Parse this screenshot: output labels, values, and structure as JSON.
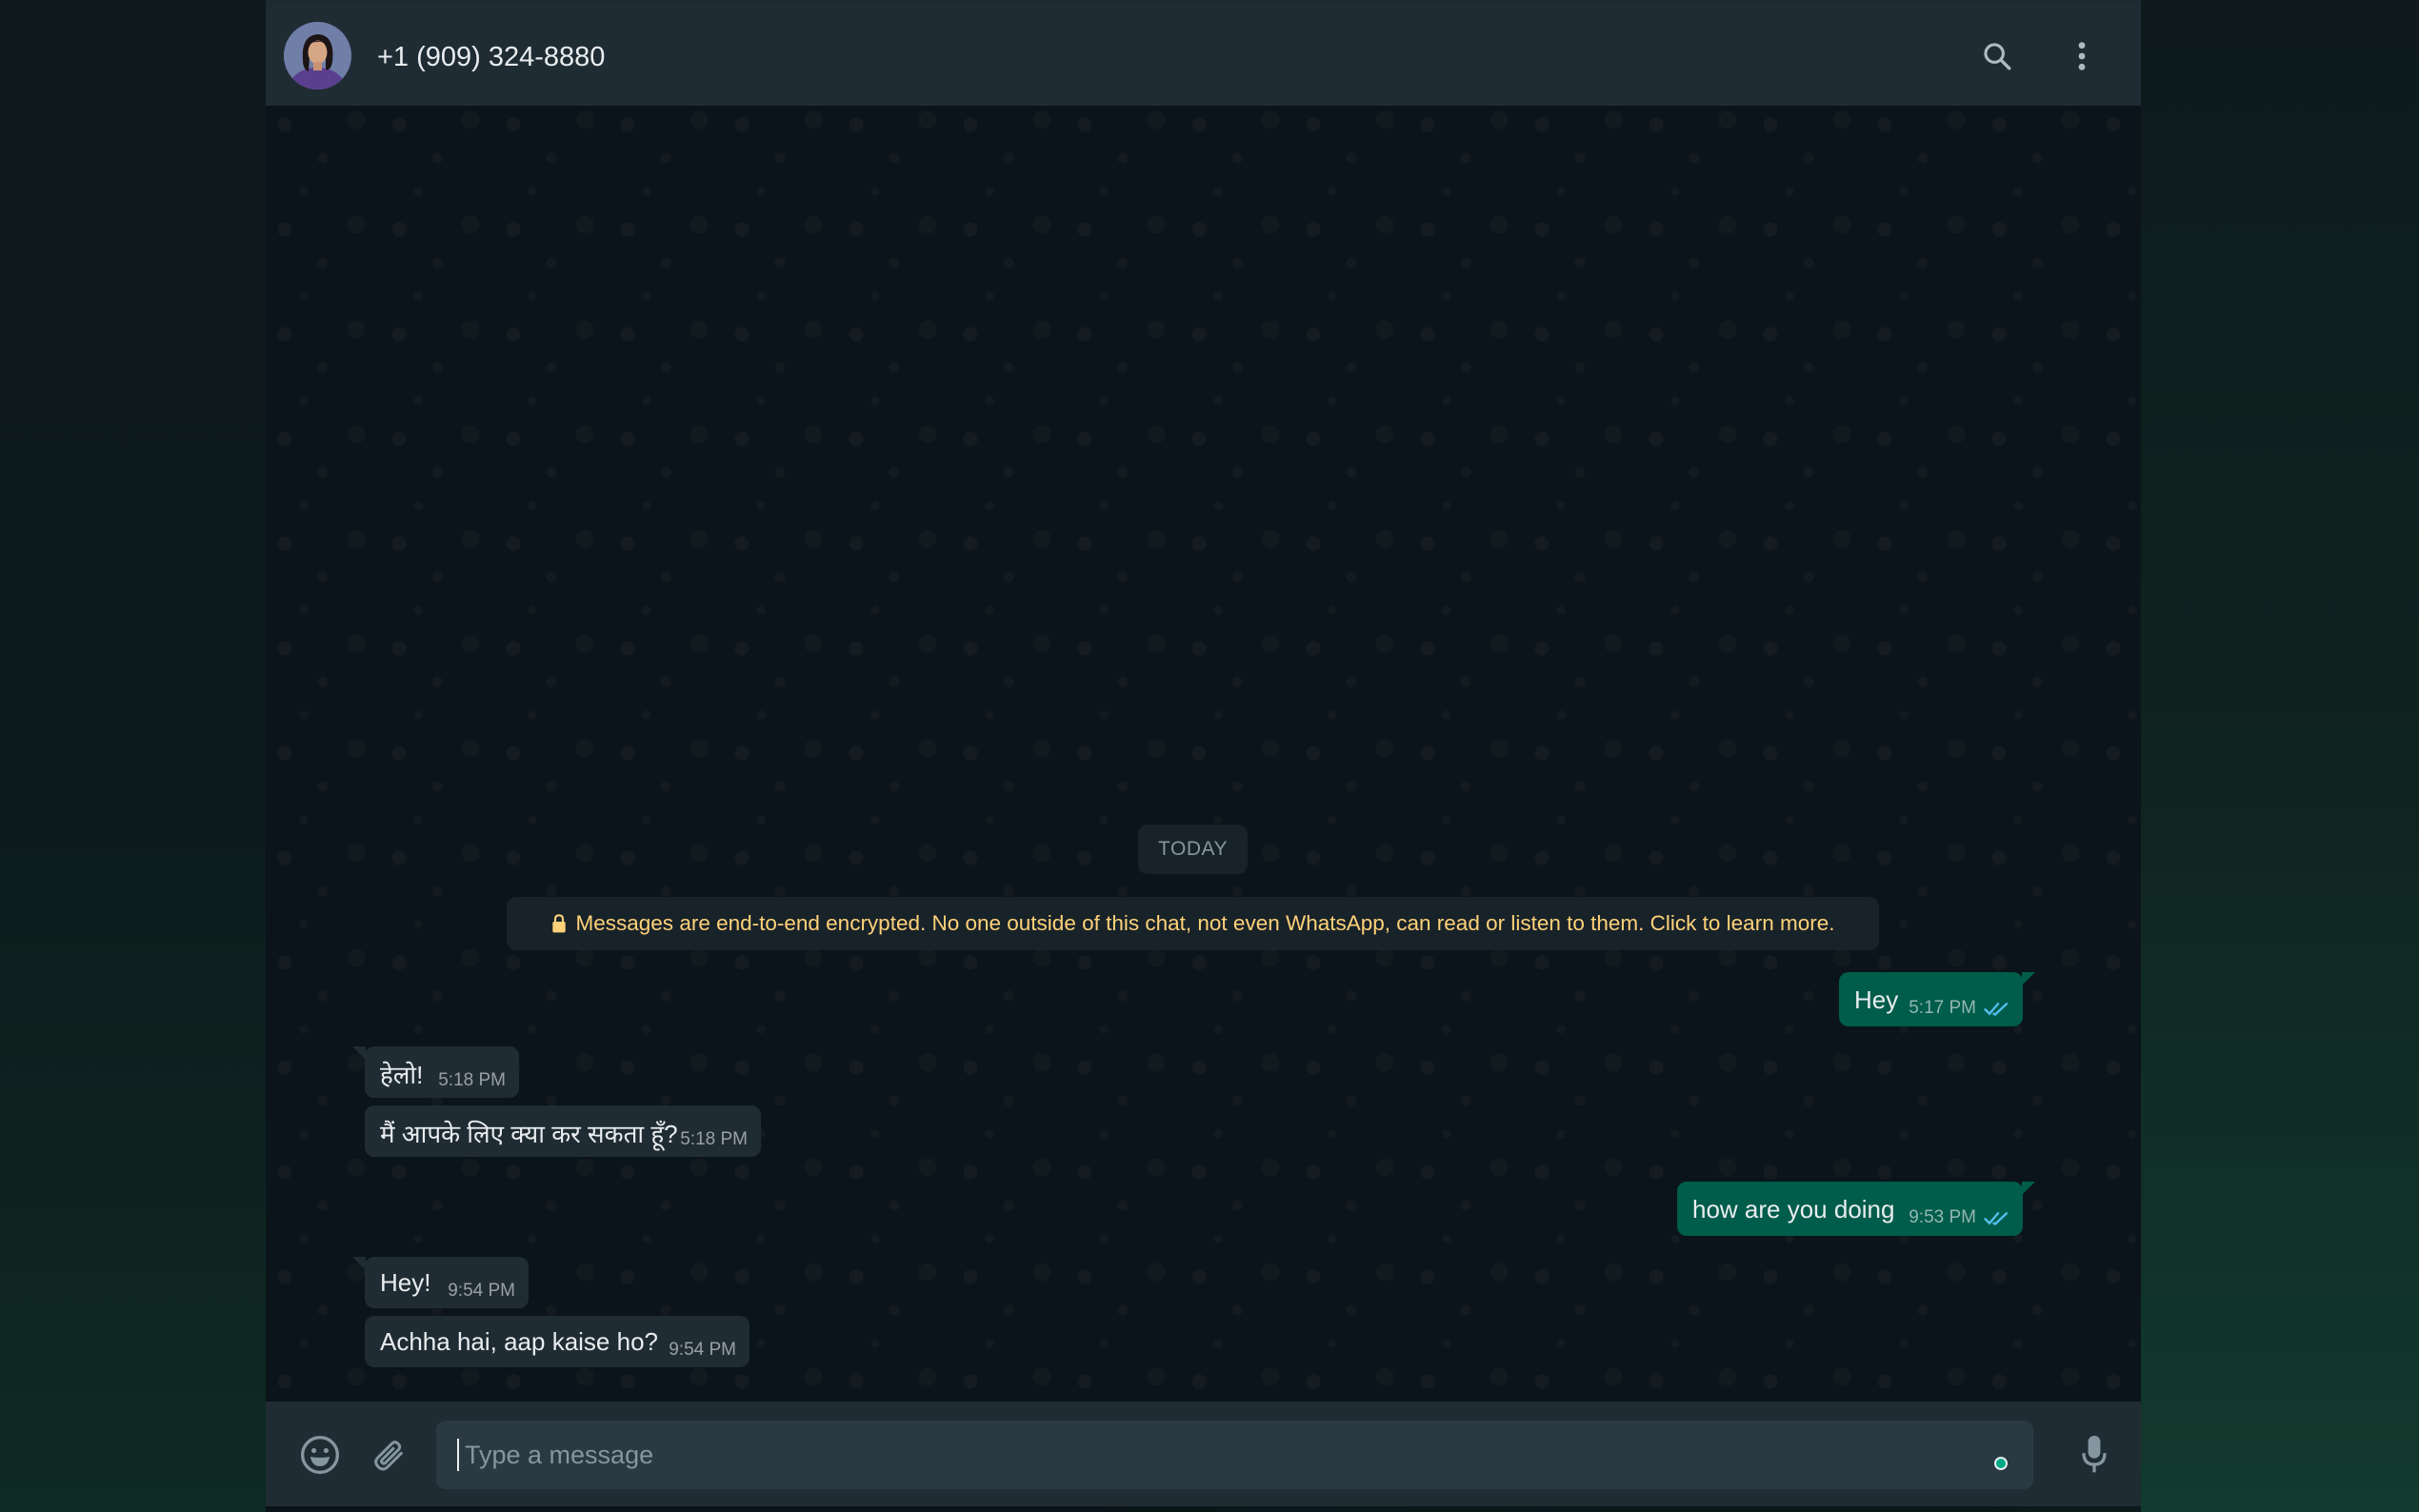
{
  "header": {
    "contact_name": "+1 (909) 324-8880",
    "avatar_icon": "contact-avatar",
    "search_icon": "search-icon",
    "menu_icon": "more-vertical-icon"
  },
  "chat": {
    "date_divider": "TODAY",
    "encryption_notice": "Messages are end-to-end encrypted. No one outside of this chat, not even WhatsApp, can read or listen to them. Click to learn more.",
    "messages": [
      {
        "direction": "outgoing",
        "text": "Hey",
        "time": "5:17 PM",
        "status": "read"
      },
      {
        "direction": "incoming",
        "text": "हेलो!",
        "time": "5:18 PM"
      },
      {
        "direction": "incoming",
        "text": "मैं आपके लिए क्या कर सकता हूँ?",
        "time": "5:18 PM"
      },
      {
        "direction": "outgoing",
        "text": "how are you doing",
        "time": "9:53 PM",
        "status": "read"
      },
      {
        "direction": "incoming",
        "text": "Hey!",
        "time": "9:54 PM"
      },
      {
        "direction": "incoming",
        "text": "Achha hai, aap kaise ho?",
        "time": "9:54 PM"
      }
    ]
  },
  "composer": {
    "placeholder": "Type a message",
    "value": "",
    "emoji_icon": "emoji-icon",
    "attach_icon": "paperclip-icon",
    "mic_icon": "microphone-icon"
  },
  "colors": {
    "header_bg": "#202c33",
    "chat_bg": "#0b141a",
    "outgoing_bubble": "#005c4b",
    "incoming_bubble": "#202c33",
    "encryption_text": "#ffd279",
    "read_ticks": "#53bdeb",
    "accent": "#00a884"
  }
}
